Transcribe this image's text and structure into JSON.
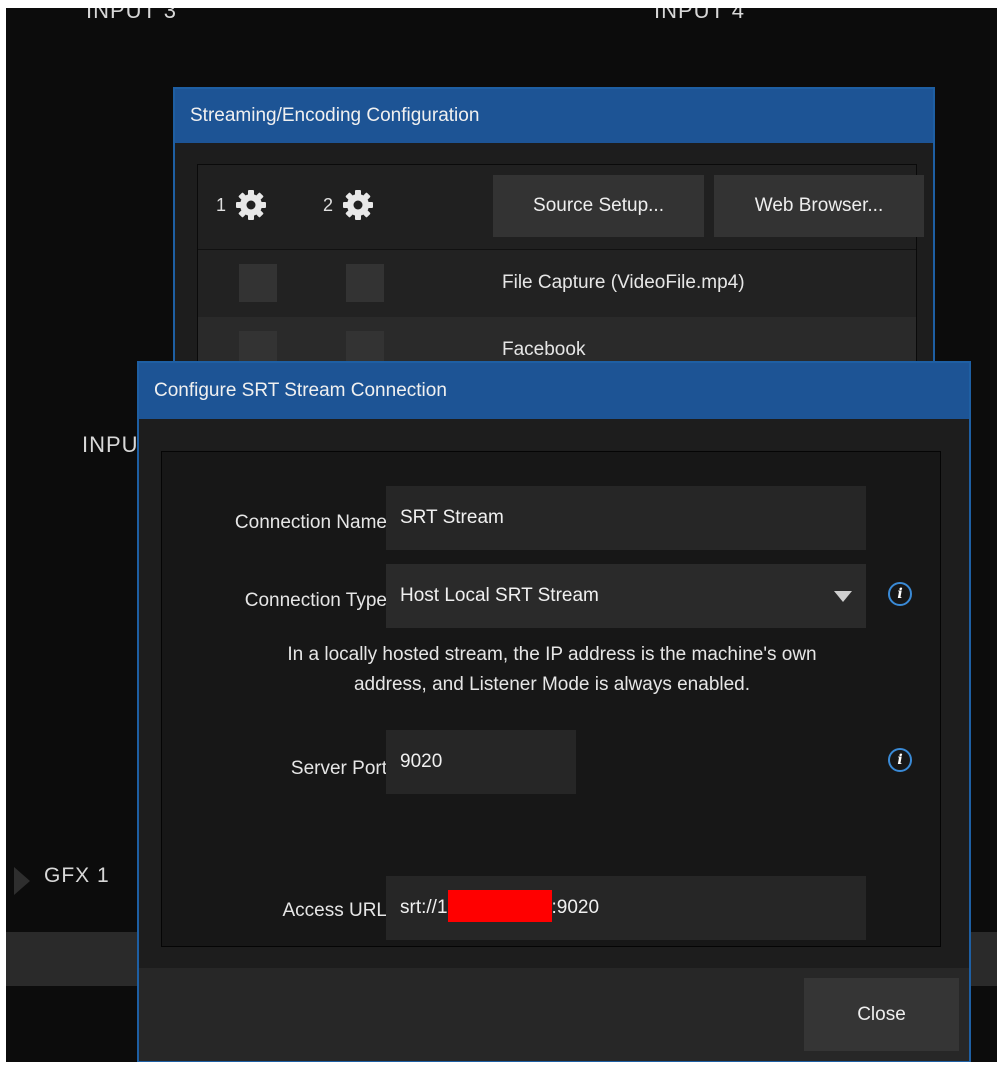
{
  "background": {
    "input3_label": "INPUT 3",
    "input4_label": "INPUT 4",
    "input_partial_label": "INPU",
    "gfx1_label": "GFX 1"
  },
  "stream_dialog": {
    "title": "Streaming/Encoding Configuration",
    "output1_number": "1",
    "output2_number": "2",
    "source_setup_label": "Source Setup...",
    "web_browser_label": "Web Browser...",
    "rows": [
      {
        "label": "File Capture (VideoFile.mp4)"
      },
      {
        "label": "Facebook"
      }
    ]
  },
  "srt_dialog": {
    "title": "Configure SRT Stream Connection",
    "connection_name_label": "Connection Name",
    "connection_name_value": "SRT Stream",
    "connection_type_label": "Connection Type",
    "connection_type_value": "Host Local SRT Stream",
    "help_text": "In a locally hosted stream, the IP address is the machine's own address, and Listener Mode is always enabled.",
    "server_port_label": "Server Port",
    "server_port_value": "9020",
    "access_url_label": "Access URL",
    "access_url_prefix": "srt://1",
    "access_url_suffix": ":9020",
    "close_label": "Close",
    "info_icon_glyph": "i"
  },
  "colors": {
    "title_bar": "#1d5495",
    "dialog_border": "#1e5fa3",
    "info_icon": "#3a8ad6",
    "redaction": "#ff0000"
  }
}
